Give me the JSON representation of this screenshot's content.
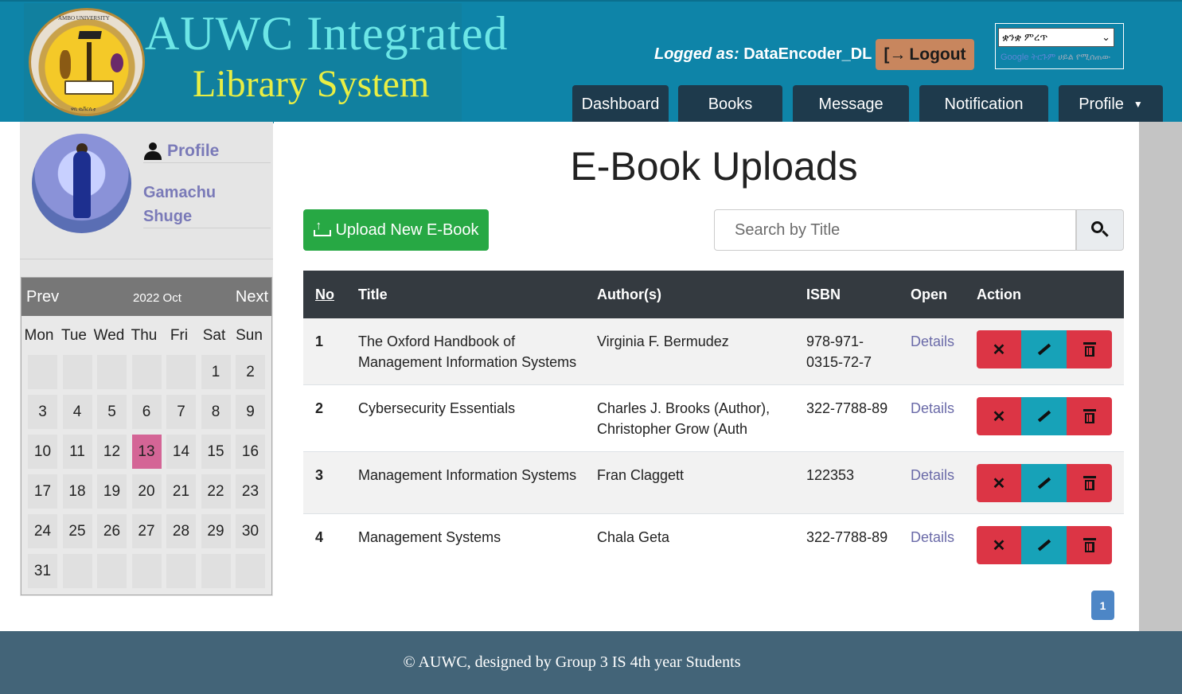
{
  "header": {
    "title_line1": "AUWC Integrated",
    "title_line2": "Library System",
    "seal_top_text": "AMBO UNIVERSITY",
    "seal_bottom_text": "ዋቢ ዩኒቨርሲቲ",
    "logged_label": "Logged as:",
    "username": "DataEncoder_DL",
    "logout_label": "Logout",
    "language_value": "ቋንቋ ምረጥ",
    "powered_by": "Google ትርጉም",
    "powered_suffix": "ሀይል የሚሰጠው",
    "nav": [
      {
        "label": "Dashboard"
      },
      {
        "label": "Books"
      },
      {
        "label": "Message"
      },
      {
        "label": "Notification"
      },
      {
        "label": "Profile"
      }
    ]
  },
  "sidebar": {
    "profile_label": "Profile",
    "name_first": "Gamachu",
    "name_last": "Shuge",
    "calendar": {
      "prev": "Prev",
      "next": "Next",
      "month": "2022 Oct",
      "weekdays": [
        "Mon",
        "Tue",
        "Wed",
        "Thu",
        "Fri",
        "Sat",
        "Sun"
      ],
      "cells": [
        "",
        "",
        "",
        "",
        "",
        "1",
        "2",
        "3",
        "4",
        "5",
        "6",
        "7",
        "8",
        "9",
        "10",
        "11",
        "12",
        "13",
        "14",
        "15",
        "16",
        "17",
        "18",
        "19",
        "20",
        "21",
        "22",
        "23",
        "24",
        "25",
        "26",
        "27",
        "28",
        "29",
        "30",
        "31",
        "",
        "",
        "",
        "",
        "",
        ""
      ],
      "today": "13",
      "today_color": "#d46596"
    }
  },
  "main": {
    "page_title": "E-Book Uploads",
    "upload_label": "Upload New E-Book",
    "search_placeholder": "Search by Title",
    "columns": {
      "no": "No",
      "title": "Title",
      "authors": "Author(s)",
      "isbn": "ISBN",
      "open": "Open",
      "action": "Action"
    },
    "rows": [
      {
        "no": "1",
        "title_l1": "The Oxford Handbook of",
        "title_l2": "Management Information Systems",
        "author_l1": "Virginia F. Bermudez",
        "author_l2": "",
        "isbn_l1": "978-971-",
        "isbn_l2": "0315-72-7",
        "open": "Details"
      },
      {
        "no": "2",
        "title_l1": "Cybersecurity Essentials",
        "title_l2": "",
        "author_l1": "Charles J. Brooks (Author),",
        "author_l2": "Christopher Grow (Auth",
        "isbn_l1": "322-7788-89",
        "isbn_l2": "",
        "open": "Details"
      },
      {
        "no": "3",
        "title_l1": "Management Information Systems",
        "title_l2": "",
        "author_l1": "Fran Claggett",
        "author_l2": "",
        "isbn_l1": "122353",
        "isbn_l2": "",
        "open": "Details"
      },
      {
        "no": "4",
        "title_l1": "Management Systems",
        "title_l2": "",
        "author_l1": "Chala Geta",
        "author_l2": "",
        "isbn_l1": "322-7788-89",
        "isbn_l2": "",
        "open": "Details"
      }
    ],
    "action_icons": [
      "close-icon",
      "pencil-icon",
      "trash-icon"
    ],
    "current_page": "1"
  },
  "footer": {
    "text": "© AUWC, designed by Group 3 IS 4th year Students"
  },
  "colors": {
    "header_bg": "#0e84a8",
    "nav_bg": "#1e3a4c",
    "logout_bg": "#c8865e",
    "upload_bg": "#27a844",
    "danger": "#dc3545",
    "info": "#17a2b8",
    "footer_bg": "#436478"
  }
}
